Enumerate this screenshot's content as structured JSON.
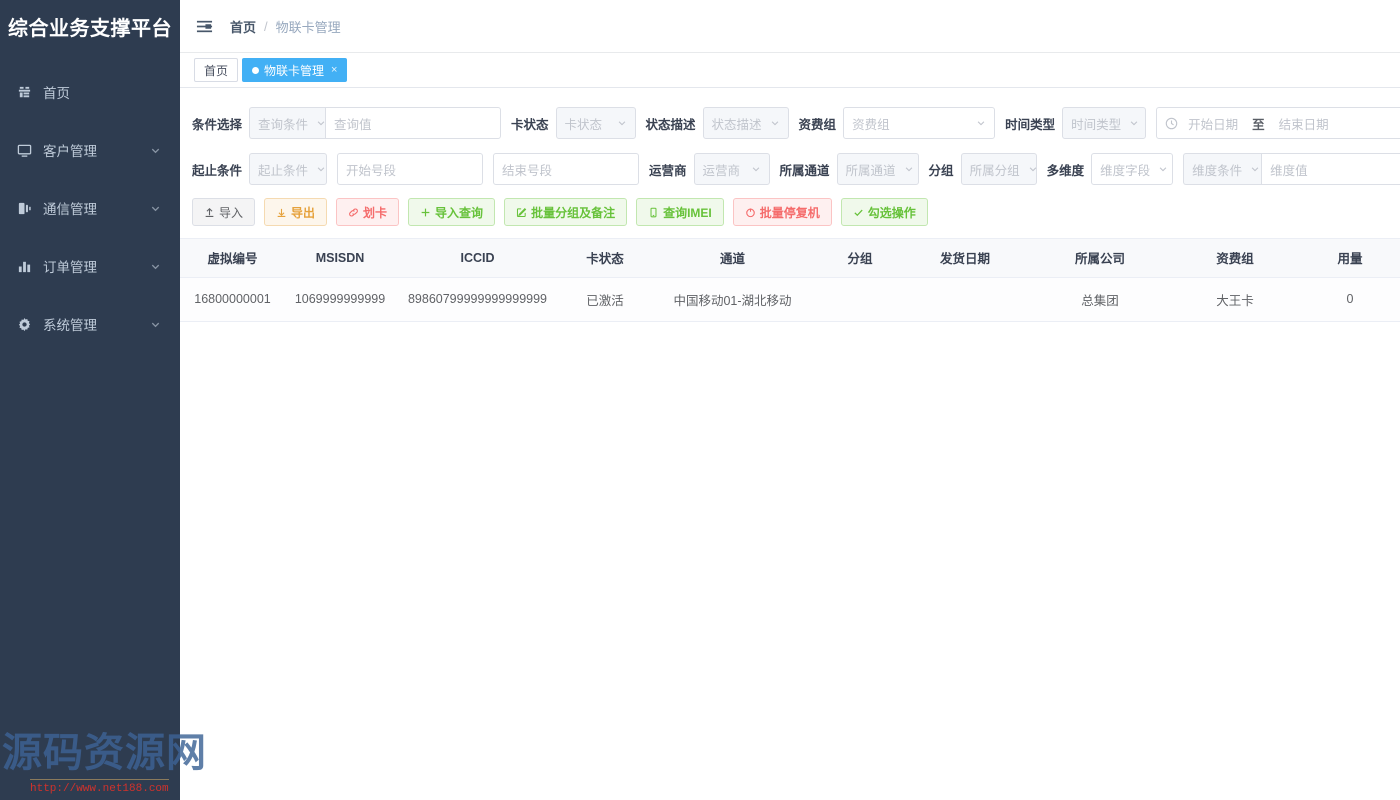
{
  "sidebar": {
    "brand": "综合业务支撑平台",
    "items": [
      {
        "label": "首页",
        "icon": "dashboard-icon",
        "expandable": false
      },
      {
        "label": "客户管理",
        "icon": "customer-icon",
        "expandable": true
      },
      {
        "label": "通信管理",
        "icon": "communication-icon",
        "expandable": true
      },
      {
        "label": "订单管理",
        "icon": "chart-bar-icon",
        "expandable": true
      },
      {
        "label": "系统管理",
        "icon": "gear-icon",
        "expandable": true
      }
    ]
  },
  "watermark": {
    "text": "源码资源网",
    "url": "http://www.net188.com"
  },
  "navbar": {
    "menu_icon": "hamburger-icon",
    "breadcrumb_home": "首页",
    "breadcrumb_sep": "/",
    "breadcrumb_current": "物联卡管理"
  },
  "tabs": [
    {
      "label": "首页",
      "active": false,
      "closable": false
    },
    {
      "label": "物联卡管理",
      "active": true,
      "closable": true,
      "close_label": "×"
    }
  ],
  "filters": {
    "row1": {
      "label_condition": "条件选择",
      "select_condition": "查询条件",
      "input_value": "查询值",
      "label_card_status": "卡状态",
      "select_card_status": "卡状态",
      "label_status_desc": "状态描述",
      "select_status_desc": "状态描述",
      "label_tariff_group": "资费组",
      "select_tariff_group": "资费组",
      "label_time_type": "时间类型",
      "select_time_type": "时间类型",
      "date_start": "开始日期",
      "date_sep": "至",
      "date_end": "结束日期"
    },
    "row2": {
      "label_range": "起止条件",
      "select_range": "起止条件",
      "input_start_segment": "开始号段",
      "input_end_segment": "结束号段",
      "label_operator": "运营商",
      "select_operator": "运营商",
      "label_channel": "所属通道",
      "select_channel": "所属通道",
      "label_group": "分组",
      "select_group": "所属分组",
      "label_multidim": "多维度",
      "select_dim_field": "维度字段",
      "select_dim_condition": "维度条件",
      "input_dim_value": "维度值"
    }
  },
  "buttons": [
    {
      "label": "导入",
      "icon": "upload-icon",
      "style": "default"
    },
    {
      "label": "导出",
      "icon": "download-icon",
      "style": "warning"
    },
    {
      "label": "划卡",
      "icon": "link-icon",
      "style": "danger"
    },
    {
      "label": "导入查询",
      "icon": "plus-icon",
      "style": "success"
    },
    {
      "label": "批量分组及备注",
      "icon": "edit-icon",
      "style": "success"
    },
    {
      "label": "查询IMEI",
      "icon": "mobile-icon",
      "style": "success"
    },
    {
      "label": "批量停复机",
      "icon": "power-icon",
      "style": "danger"
    },
    {
      "label": "勾选操作",
      "icon": "check-icon",
      "style": "success"
    }
  ],
  "table": {
    "columns": [
      "虚拟编号",
      "MSISDN",
      "ICCID",
      "卡状态",
      "通道",
      "分组",
      "发货日期",
      "所属公司",
      "资费组",
      "用量"
    ],
    "rows": [
      {
        "虚拟编号": "16800000001",
        "MSISDN": "1069999999999",
        "ICCID": "89860799999999999999",
        "卡状态": "已激活",
        "通道": "中国移动01-湖北移动",
        "分组": "",
        "发货日期": "",
        "所属公司": "总集团",
        "资费组": "大王卡",
        "用量": "0"
      }
    ]
  },
  "colors": {
    "sidebar_bg": "#2e3c50",
    "tab_active": "#42b0f5",
    "link": "#4a90d9",
    "warning": "#e6a23c",
    "danger": "#f56c6c",
    "success": "#67c23a"
  }
}
